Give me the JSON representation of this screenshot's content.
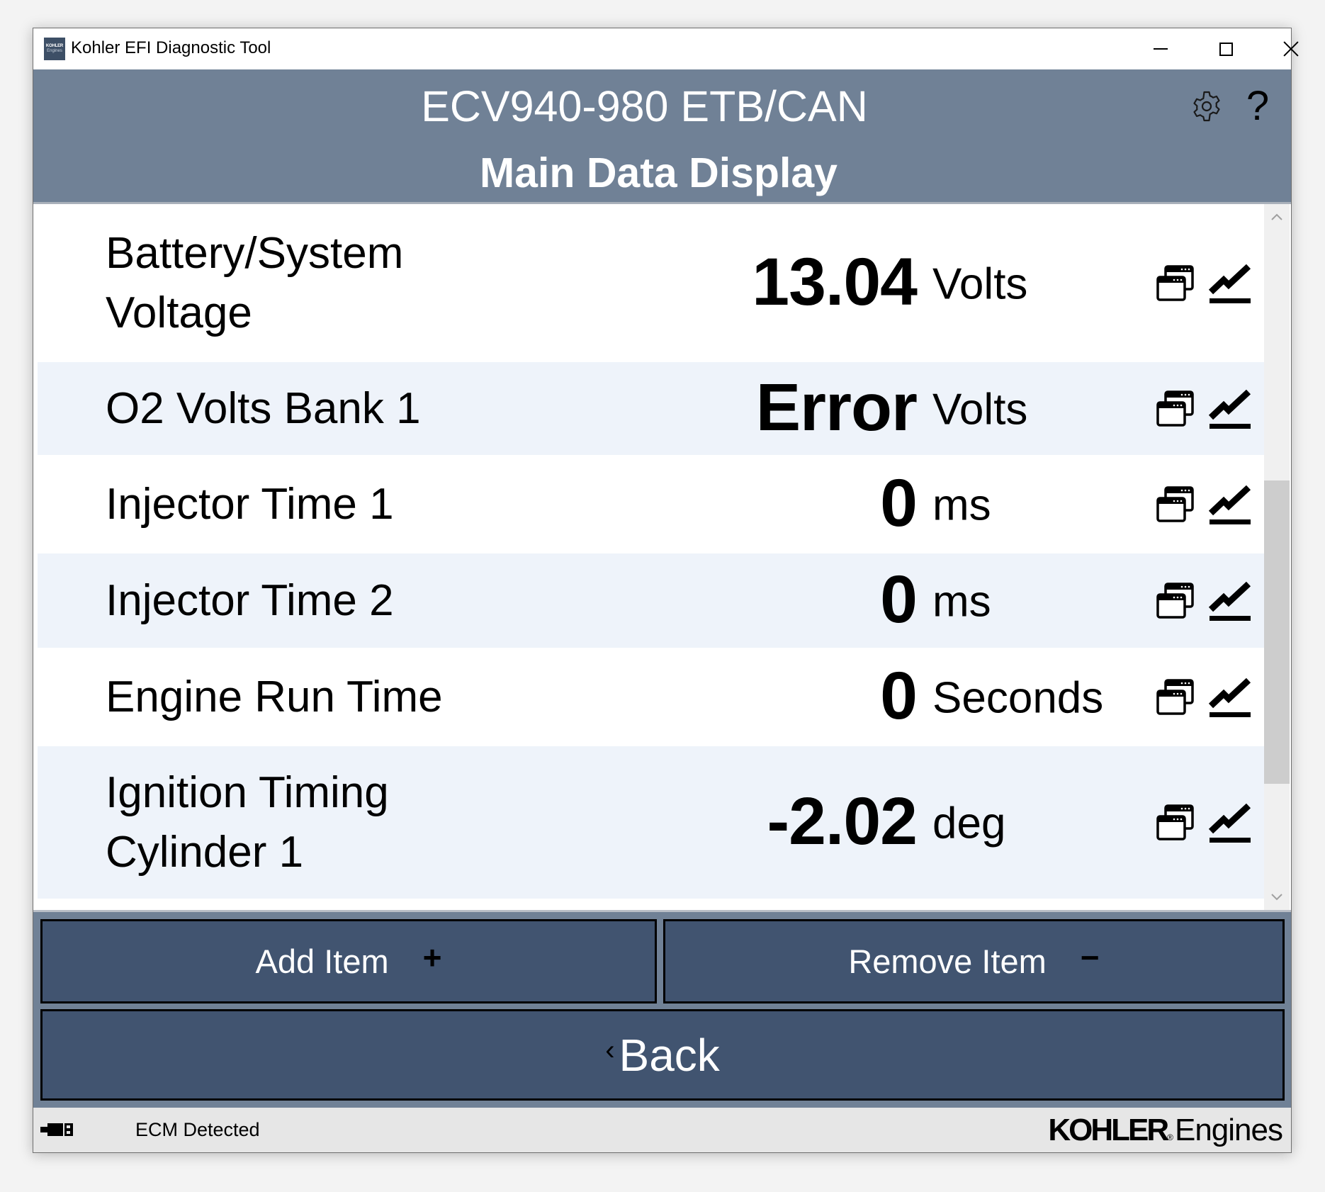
{
  "window": {
    "title": "Kohler EFI Diagnostic Tool",
    "app_icon": {
      "line1": "KOHLER",
      "line2": "Engines"
    },
    "controls": {
      "minimize": "minimize-icon",
      "maximize": "maximize-icon",
      "close": "close-icon"
    }
  },
  "header": {
    "title": "ECV940-980 ETB/CAN",
    "subtitle": "Main Data Display",
    "settings_icon": "gear-icon",
    "help_label": "?"
  },
  "rows": [
    {
      "label": "Battery/System Voltage",
      "value": "13.04",
      "unit": "Volts"
    },
    {
      "label": "O2 Volts Bank 1",
      "value": "Error",
      "unit": "Volts"
    },
    {
      "label": "Injector Time 1",
      "value": "0",
      "unit": "ms"
    },
    {
      "label": "Injector Time 2",
      "value": "0",
      "unit": "ms"
    },
    {
      "label": "Engine Run Time",
      "value": "0",
      "unit": "Seconds"
    },
    {
      "label": "Ignition Timing Cylinder 1",
      "value": "-2.02",
      "unit": "deg"
    }
  ],
  "row_icons": {
    "popout": "popout-window-icon",
    "chart": "trend-chart-icon"
  },
  "buttons": {
    "add_label": "Add Item",
    "add_symbol": "+",
    "remove_label": "Remove Item",
    "remove_symbol": "−",
    "back_chevron": "‹",
    "back_label": "Back"
  },
  "status": {
    "connection_icon": "usb-plug-icon",
    "text": "ECM Detected",
    "brand_bold": "KOHLER",
    "brand_reg": "®",
    "brand_light": "Engines"
  },
  "colors": {
    "header_bg": "#708196",
    "button_bg": "#415470",
    "row_alt_bg": "#eef3fa",
    "status_bg": "#e6e6e6"
  }
}
